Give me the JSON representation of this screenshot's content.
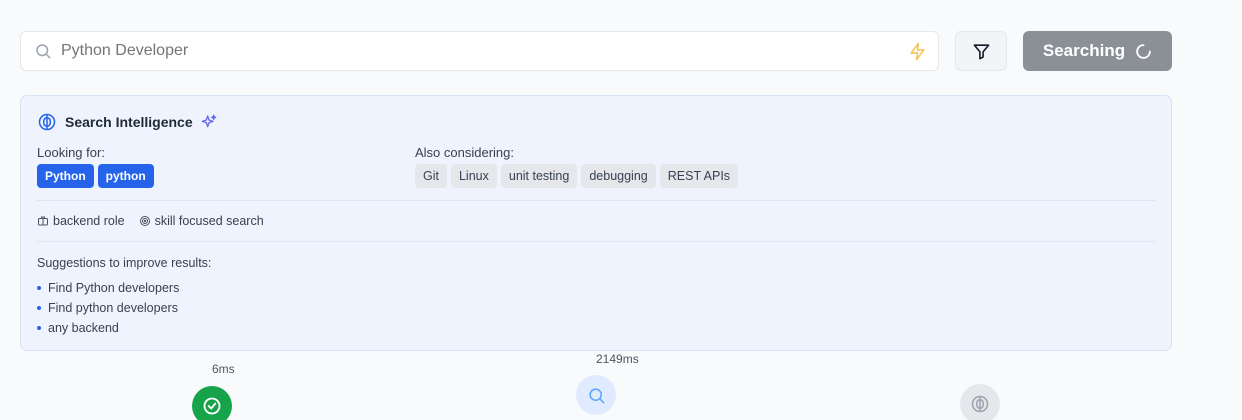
{
  "search": {
    "placeholder": "Python Developer",
    "button_label": "Searching"
  },
  "intelligence": {
    "title": "Search Intelligence",
    "looking_for_label": "Looking for:",
    "looking_for": [
      "Python",
      "python"
    ],
    "also_considering_label": "Also considering:",
    "also_considering": [
      "Git",
      "Linux",
      "unit testing",
      "debugging",
      "REST APIs"
    ],
    "tags": [
      {
        "icon": "briefcase-icon",
        "label": "backend role"
      },
      {
        "icon": "target-icon",
        "label": "skill focused search"
      }
    ],
    "suggestions_label": "Suggestions to improve results:",
    "suggestions": [
      "Find Python developers",
      "Find python developers",
      "any backend"
    ]
  },
  "steps": [
    {
      "time": "6ms",
      "icon": "check-icon",
      "status": "complete"
    },
    {
      "time": "2149ms",
      "icon": "search-icon",
      "status": "active"
    },
    {
      "time": "",
      "icon": "brain-icon",
      "status": "pending"
    }
  ],
  "colors": {
    "accent": "#2563eb",
    "success": "#16a34a",
    "button_disabled": "#8b9097",
    "bolt": "#f5c451"
  }
}
